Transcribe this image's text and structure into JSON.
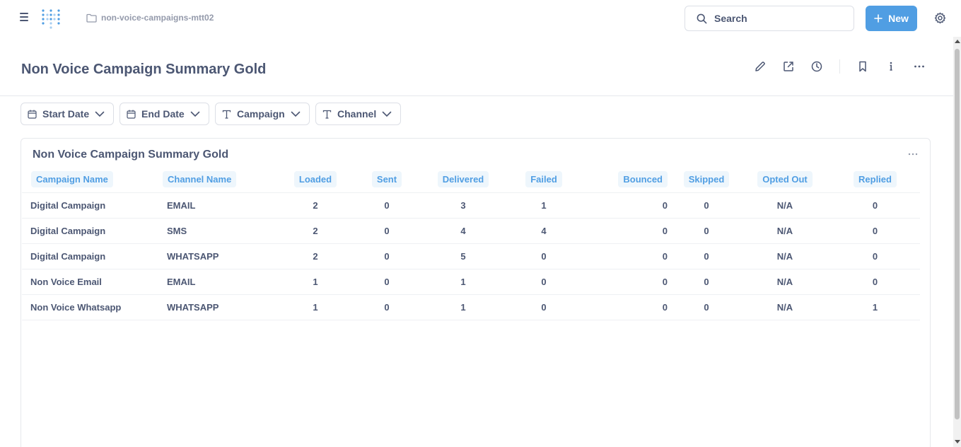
{
  "topnav": {
    "breadcrumb": "non-voice-campaigns-mtt02",
    "search_placeholder": "Search",
    "new_label": "New",
    "accent": "#509ee3"
  },
  "header": {
    "title": "Non Voice Campaign Summary Gold",
    "actions": [
      "pencil-icon",
      "share-icon",
      "clock-icon",
      "bookmark-icon",
      "info-icon",
      "more-icon"
    ]
  },
  "filters": [
    {
      "label": "Start Date",
      "icon": "calendar-icon"
    },
    {
      "label": "End Date",
      "icon": "calendar-icon"
    },
    {
      "label": "Campaign",
      "icon": "text-icon"
    },
    {
      "label": "Channel",
      "icon": "text-icon"
    }
  ],
  "card": {
    "title": "Non Voice Campaign Summary Gold",
    "columns": [
      "Campaign Name",
      "Channel Name",
      "Loaded",
      "Sent",
      "Delivered",
      "Failed",
      "Bounced",
      "Skipped",
      "Opted Out",
      "Replied"
    ],
    "rows": [
      [
        "Digital Campaign",
        "EMAIL",
        "2",
        "0",
        "3",
        "1",
        "0",
        "0",
        "N/A",
        "0"
      ],
      [
        "Digital Campaign",
        "SMS",
        "2",
        "0",
        "4",
        "4",
        "0",
        "0",
        "N/A",
        "0"
      ],
      [
        "Digital Campaign",
        "WHATSAPP",
        "2",
        "0",
        "5",
        "0",
        "0",
        "0",
        "N/A",
        "0"
      ],
      [
        "Non Voice Email",
        "EMAIL",
        "1",
        "0",
        "1",
        "0",
        "0",
        "0",
        "N/A",
        "0"
      ],
      [
        "Non Voice Whatsapp",
        "WHATSAPP",
        "1",
        "0",
        "1",
        "0",
        "0",
        "0",
        "N/A",
        "1"
      ]
    ]
  }
}
